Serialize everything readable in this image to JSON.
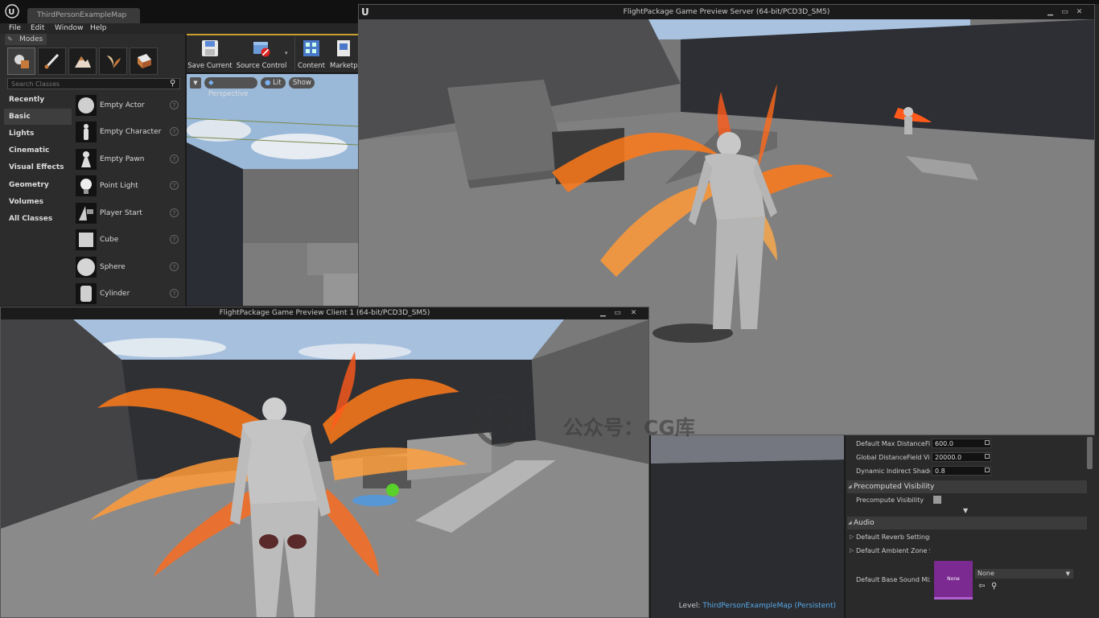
{
  "editor": {
    "tab_title": "ThirdPersonExampleMap",
    "menu": [
      "File",
      "Edit",
      "Window",
      "Help"
    ]
  },
  "modes": {
    "tab_label": "Modes",
    "search_placeholder": "Search Classes",
    "categories": [
      "Recently Placed",
      "Basic",
      "Lights",
      "Cinematic",
      "Visual Effects",
      "Geometry",
      "Volumes",
      "All Classes"
    ],
    "active_category": "Basic",
    "items": [
      "Empty Actor",
      "Empty Character",
      "Empty Pawn",
      "Point Light",
      "Player Start",
      "Cube",
      "Sphere",
      "Cylinder"
    ],
    "help_glyph": "?"
  },
  "toolbar": {
    "save_label": "Save Current",
    "source_control_label": "Source Control",
    "content_label": "Content",
    "marketplace_label": "Marketp"
  },
  "viewport": {
    "perspective_label": "Perspective",
    "lit_label": "Lit",
    "show_label": "Show"
  },
  "server_window": {
    "title": "FlightPackage Game Preview Server (64-bit/PCD3D_SM5)"
  },
  "client_window": {
    "title": "FlightPackage Game Preview Client 1 (64-bit/PCD3D_SM5)"
  },
  "level_bar": {
    "prefix": "Level:",
    "value": "ThirdPersonExampleMap (Persistent)"
  },
  "details": {
    "rows": [
      {
        "label": "Default Max DistanceField",
        "value": "600.0"
      },
      {
        "label": "Global DistanceField View",
        "value": "20000.0"
      },
      {
        "label": "Dynamic Indirect Shadow",
        "value": "0.8"
      }
    ],
    "precomputed_header": "Precomputed Visibility",
    "precompute_label": "Precompute Visibility",
    "audio_header": "Audio",
    "reverb_label": "Default Reverb Settings",
    "ambient_label": "Default Ambient Zone Set",
    "sound_mix_label": "Default Base Sound Mix",
    "thumb_text": "None",
    "combo_value": "None"
  },
  "watermark": {
    "logo_text": "CG库",
    "caption": "公众号：CG库"
  },
  "colors": {
    "accent_gold": "#c8a030",
    "level_blue": "#5aa9e6",
    "sound_mix_purple": "#7a2a90",
    "fire_orange": "#ff7a1a"
  }
}
